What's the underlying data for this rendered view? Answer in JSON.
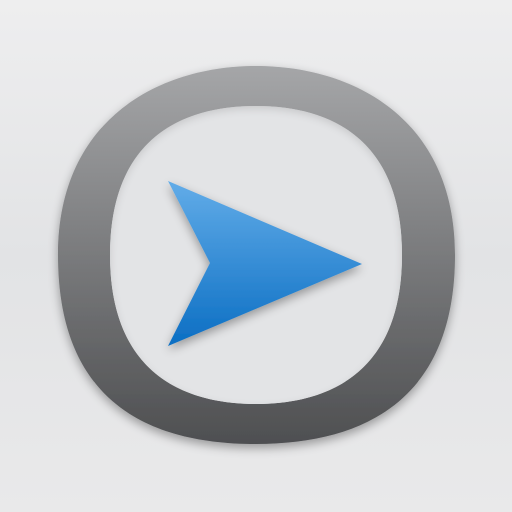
{
  "icon": {
    "name": "play-arrow-app-icon",
    "ring_icon": "rounded-ring-icon",
    "arrow_icon": "play-arrow-icon",
    "colors": {
      "background_top": "#eeeeef",
      "background_mid": "#e2e3e5",
      "background_bottom": "#e9e9ea",
      "ring_top": "#a5a6a8",
      "ring_bottom": "#4e4f51",
      "ring_inner_face": "#e3e4e6",
      "arrow_top": "#62ace8",
      "arrow_bottom": "#0b6ec3"
    }
  }
}
